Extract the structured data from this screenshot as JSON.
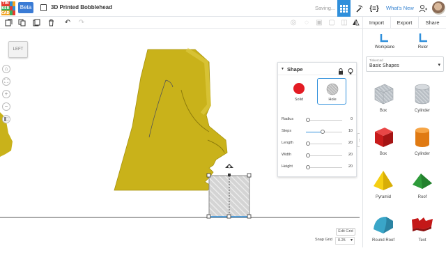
{
  "app": {
    "logo_letters": [
      "TIN",
      "KER",
      "CAD"
    ],
    "beta_label": "Beta",
    "document_title": "3D Printed Bobblehead",
    "status_text": "Saving...",
    "whats_new": "What's New"
  },
  "toolbar": {
    "import_label": "Import",
    "export_label": "Export",
    "share_label": "Share"
  },
  "viewcube": {
    "label": "LEFT"
  },
  "inspector": {
    "title": "Shape",
    "solid_label": "Solid",
    "hole_label": "Hole",
    "selected": "Hole",
    "params": [
      {
        "label": "Radius",
        "value": "0",
        "fraction": 0.0
      },
      {
        "label": "Steps",
        "value": "10",
        "fraction": 0.4
      },
      {
        "label": "Length",
        "value": "20",
        "fraction": 0.0
      },
      {
        "label": "Width",
        "value": "20",
        "fraction": 0.0
      },
      {
        "label": "Height",
        "value": "20",
        "fraction": 0.0
      }
    ]
  },
  "grid": {
    "edit_grid": "Edit Grid",
    "snap_label": "Snap Grid",
    "snap_value": "0.25"
  },
  "panel": {
    "workplane": "Workplane",
    "ruler": "Ruler",
    "library_sub": "Tinkercad",
    "library_name": "Basic Shapes",
    "shapes": [
      {
        "name": "Box",
        "icon": "box-hole-icon"
      },
      {
        "name": "Cylinder",
        "icon": "cylinder-hole-icon"
      },
      {
        "name": "Box",
        "icon": "box-red-icon"
      },
      {
        "name": "Cylinder",
        "icon": "cylinder-orange-icon"
      },
      {
        "name": "Pyramid",
        "icon": "pyramid-icon"
      },
      {
        "name": "Roof",
        "icon": "roof-icon"
      },
      {
        "name": "Round Roof",
        "icon": "round-roof-icon"
      },
      {
        "name": "Text",
        "icon": "text-3d-icon"
      }
    ]
  },
  "colors": {
    "accent": "#2f8fdb",
    "moai": "#c9b21a",
    "solid_red": "#e31b23",
    "box_red": "#d41d1d",
    "cyl_orange": "#f08a1e",
    "pyramid_yellow": "#f5cf13",
    "roof_green": "#2e9b3a",
    "round_roof_teal": "#3aa6c8"
  }
}
